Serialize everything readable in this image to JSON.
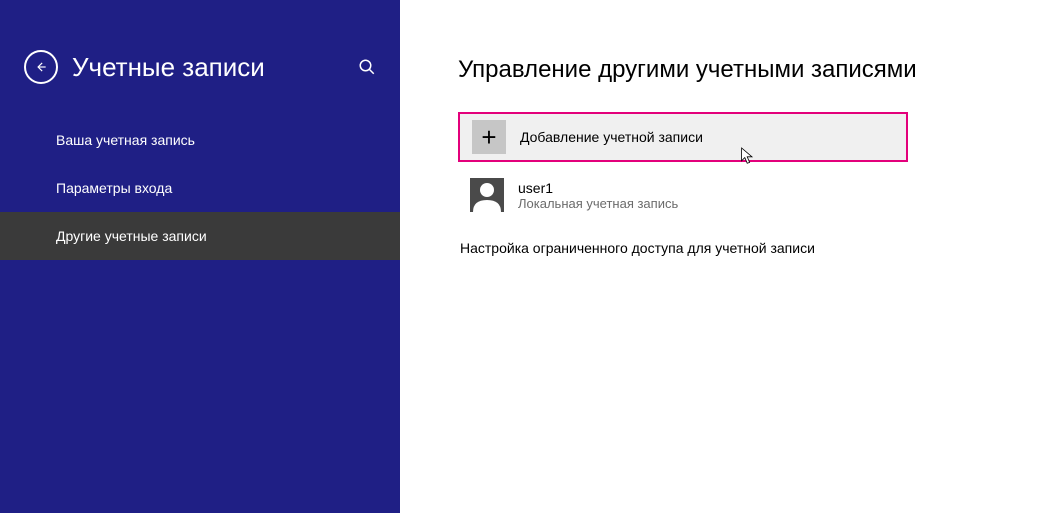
{
  "sidebar": {
    "title": "Учетные записи",
    "items": [
      {
        "label": "Ваша учетная запись"
      },
      {
        "label": "Параметры входа"
      },
      {
        "label": "Другие учетные записи"
      }
    ],
    "active_index": 2
  },
  "main": {
    "title": "Управление другими учетными записями",
    "add_label": "Добавление учетной записи",
    "user": {
      "name": "user1",
      "type": "Локальная учетная запись"
    },
    "restricted_link": "Настройка ограниченного доступа для учетной записи"
  },
  "colors": {
    "sidebar_bg": "#1f1f85",
    "nav_active_bg": "#3a3a3a",
    "highlight_border": "#e3007b",
    "add_row_bg": "#f0f0f0",
    "plus_box_bg": "#c6c6c6",
    "avatar_bg": "#4a4a4a"
  }
}
